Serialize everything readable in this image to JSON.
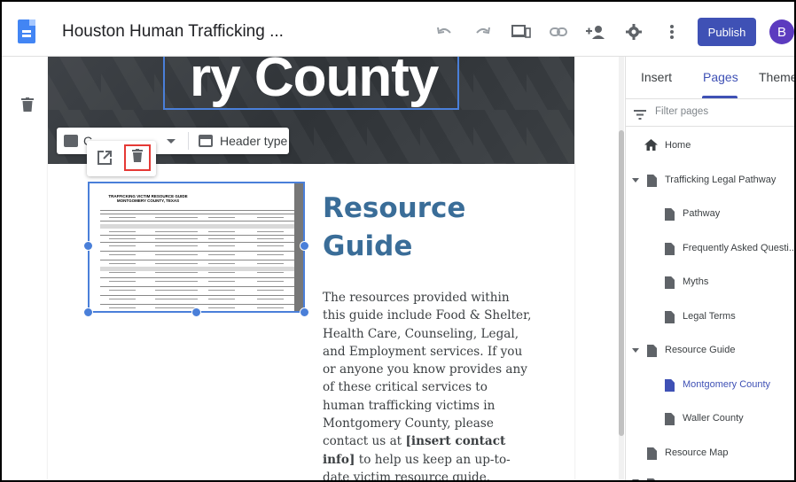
{
  "header": {
    "doc_title": "Houston Human Trafficking ...",
    "publish_label": "Publish",
    "avatar_initial": "B"
  },
  "editor": {
    "hero_title": "ry County",
    "header_toolbar": {
      "image_label_partial": "C",
      "header_type_label": "Header type"
    },
    "thumbnail": {
      "doc_heading": "TRAFFICKING VICTIM RESOURCE GUIDE MONTGOMERY COUNTY, TEXAS"
    },
    "guide_title_line1": "Resource",
    "guide_title_line2": "Guide",
    "body_part1": "The resources provided within this guide include Food & Shelter, Health Care, Counseling, Legal, and Employment services. If you or anyone you know provides any of these critical services to human trafficking victims in Montgomery County, please contact us at ",
    "body_bold": "[insert contact info]",
    "body_part2": " to help us keep an up-to-date victim resource guide."
  },
  "panel": {
    "tabs": [
      {
        "label": "Insert"
      },
      {
        "label": "Pages"
      },
      {
        "label": "Themes"
      }
    ],
    "filter_placeholder": "Filter pages",
    "pages": [
      {
        "label": "Home"
      },
      {
        "label": "Trafficking Legal Pathway"
      },
      {
        "label": "Pathway"
      },
      {
        "label": "Frequently Asked Questi..."
      },
      {
        "label": "Myths"
      },
      {
        "label": "Legal Terms"
      },
      {
        "label": "Resource Guide"
      },
      {
        "label": "Montgomery County"
      },
      {
        "label": "Waller County"
      },
      {
        "label": "Resource Map"
      }
    ]
  },
  "colors": {
    "accent": "#3f51b5",
    "selection": "#4a7fd9",
    "delete_highlight": "#e53935",
    "guide_title": "#3a6d98"
  }
}
